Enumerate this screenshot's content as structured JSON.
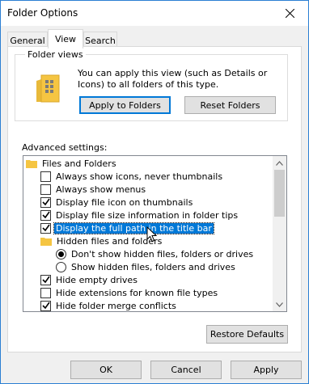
{
  "window": {
    "title": "Folder Options"
  },
  "tabs": [
    {
      "label": "General"
    },
    {
      "label": "View",
      "active": true
    },
    {
      "label": "Search"
    }
  ],
  "folder_views": {
    "legend": "Folder views",
    "description": "You can apply this view (such as Details or Icons) to all folders of this type.",
    "apply_label": "Apply to Folders",
    "reset_label": "Reset Folders"
  },
  "advanced": {
    "label": "Advanced settings:",
    "items": [
      {
        "kind": "folder",
        "text": "Files and Folders"
      },
      {
        "kind": "check",
        "checked": false,
        "text": "Always show icons, never thumbnails"
      },
      {
        "kind": "check",
        "checked": false,
        "text": "Always show menus"
      },
      {
        "kind": "check",
        "checked": true,
        "text": "Display file icon on thumbnails"
      },
      {
        "kind": "check",
        "checked": true,
        "text": "Display file size information in folder tips"
      },
      {
        "kind": "check",
        "checked": true,
        "text": "Display the full path in the title bar",
        "selected": true
      },
      {
        "kind": "folder",
        "text": "Hidden files and folders"
      },
      {
        "kind": "radio",
        "checked": true,
        "text": "Don't show hidden files, folders or drives"
      },
      {
        "kind": "radio",
        "checked": false,
        "text": "Show hidden files, folders and drives"
      },
      {
        "kind": "check",
        "checked": true,
        "text": "Hide empty drives"
      },
      {
        "kind": "check",
        "checked": false,
        "text": "Hide extensions for known file types"
      },
      {
        "kind": "check",
        "checked": true,
        "text": "Hide folder merge conflicts"
      }
    ]
  },
  "buttons": {
    "restore_defaults": "Restore Defaults",
    "ok": "OK",
    "cancel": "Cancel",
    "apply": "Apply"
  },
  "colors": {
    "selection": "#0078d7",
    "accent_border": "#0078d7",
    "folder_yellow": "#f5c542"
  },
  "icons": [
    "close-icon",
    "folder-views-icon",
    "folder-icon",
    "checkbox-icon",
    "radio-icon",
    "scroll-up-icon",
    "scroll-down-icon",
    "mouse-cursor-icon"
  ]
}
